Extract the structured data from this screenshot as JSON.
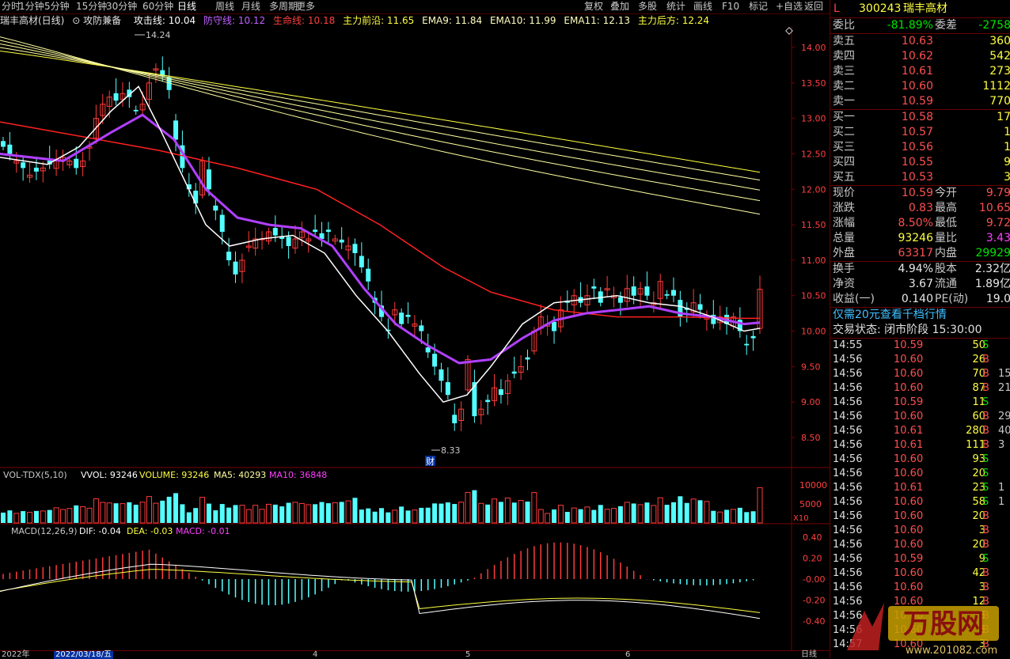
{
  "toolbar": {
    "periods": [
      "分时",
      "1分钟",
      "5分钟",
      "15分钟",
      "30分钟",
      "60分钟",
      "日线",
      "周线",
      "月线",
      "多周期",
      "更多"
    ],
    "active": "日线",
    "actions": [
      "复权",
      "叠加",
      "多股",
      "统计",
      "画线",
      "F10",
      "标记",
      "+自选",
      "返回"
    ]
  },
  "info": {
    "name": "瑞丰高材(日线)",
    "indicator": "攻防兼备",
    "attack": "攻击线: 10.04",
    "defense": "防守线: 10.12",
    "life": "生命线: 10.18",
    "main_front": "主力前沿: 11.65",
    "ema9": "EMA9: 11.84",
    "ema10": "EMA10: 11.99",
    "ema11": "EMA11: 12.13",
    "main_back": "主力后方: 12.24"
  },
  "chart_data": {
    "type": "candlestick",
    "price_axis": [
      "14.00",
      "13.50",
      "13.00",
      "12.50",
      "12.00",
      "11.50",
      "11.00",
      "10.50",
      "10.00",
      "9.50",
      "9.00",
      "8.50"
    ],
    "high_label": "14.24",
    "low_label": "8.33",
    "event_label": "财",
    "vol_title": "VOL-TDX(5,10)",
    "vol_vvol": "VVOL: 93246",
    "vol_volume": "VOLUME: 93246",
    "vol_ma5": "MA5: 40293",
    "vol_ma10": "MA10: 36848",
    "vol_axis": [
      "10000",
      "5000"
    ],
    "vol_unit": "X10",
    "macd_title": "MACD(12,26,9)",
    "macd_dif": "DIF: -0.04",
    "macd_dea": "DEA: -0.03",
    "macd_macd": "MACD: -0.01",
    "macd_axis": [
      "0.40",
      "0.20",
      "-0.00",
      "-0.20",
      "-0.40"
    ],
    "dates": [
      "2022年",
      "2022/03/18/五",
      "4",
      "5",
      "6"
    ],
    "date_right": "日线"
  },
  "quote": {
    "code": "300243",
    "name": "瑞丰高材",
    "flag": "L",
    "weibi_label": "委比",
    "weibi": "-81.89%",
    "weicha_label": "委差",
    "weicha": "-2758",
    "asks": [
      {
        "label": "卖五",
        "price": "10.63",
        "vol": "360"
      },
      {
        "label": "卖四",
        "price": "10.62",
        "vol": "542"
      },
      {
        "label": "卖三",
        "price": "10.61",
        "vol": "273"
      },
      {
        "label": "卖二",
        "price": "10.60",
        "vol": "1112"
      },
      {
        "label": "卖一",
        "price": "10.59",
        "vol": "770"
      }
    ],
    "bids": [
      {
        "label": "买一",
        "price": "10.58",
        "vol": "17"
      },
      {
        "label": "买二",
        "price": "10.57",
        "vol": "1"
      },
      {
        "label": "买三",
        "price": "10.56",
        "vol": "1"
      },
      {
        "label": "买四",
        "price": "10.55",
        "vol": "9"
      },
      {
        "label": "买五",
        "price": "10.53",
        "vol": "3"
      }
    ],
    "stats": [
      {
        "l1": "现价",
        "v1": "10.59",
        "c1": "red",
        "l2": "今开",
        "v2": "9.79",
        "c2": "red"
      },
      {
        "l1": "涨跌",
        "v1": "0.83",
        "c1": "red",
        "l2": "最高",
        "v2": "10.65",
        "c2": "red"
      },
      {
        "l1": "涨幅",
        "v1": "8.50%",
        "c1": "red",
        "l2": "最低",
        "v2": "9.72",
        "c2": "red"
      },
      {
        "l1": "总量",
        "v1": "93246",
        "c1": "yellow",
        "l2": "量比",
        "v2": "3.43",
        "c2": "magenta"
      },
      {
        "l1": "外盘",
        "v1": "63317",
        "c1": "red",
        "l2": "内盘",
        "v2": "29929",
        "c2": "green"
      }
    ],
    "stats2": [
      {
        "l1": "换手",
        "v1": "4.94%",
        "l2": "股本",
        "v2": "2.32亿"
      },
      {
        "l1": "净资",
        "v1": "3.67",
        "l2": "流通",
        "v2": "1.89亿"
      },
      {
        "l1": "收益(一)",
        "v1": "0.140",
        "l2": "PE(动)",
        "v2": "19.0"
      }
    ],
    "promo": "仅需20元查看千档行情",
    "status": "交易状态: 闭市阶段 15:30:00"
  },
  "trades": [
    {
      "t": "14:55",
      "p": "10.59",
      "q": "50",
      "d": "S",
      "x": ""
    },
    {
      "t": "14:56",
      "p": "10.60",
      "q": "26",
      "d": "B",
      "x": ""
    },
    {
      "t": "14:56",
      "p": "10.60",
      "q": "70",
      "d": "B",
      "x": "15"
    },
    {
      "t": "14:56",
      "p": "10.60",
      "q": "87",
      "d": "B",
      "x": "21"
    },
    {
      "t": "14:56",
      "p": "10.59",
      "q": "11",
      "d": "S",
      "x": ""
    },
    {
      "t": "14:56",
      "p": "10.60",
      "q": "60",
      "d": "B",
      "x": "29"
    },
    {
      "t": "14:56",
      "p": "10.61",
      "q": "280",
      "d": "B",
      "x": "40"
    },
    {
      "t": "14:56",
      "p": "10.61",
      "q": "111",
      "d": "B",
      "x": "3"
    },
    {
      "t": "14:56",
      "p": "10.60",
      "q": "93",
      "d": "S",
      "x": ""
    },
    {
      "t": "14:56",
      "p": "10.60",
      "q": "20",
      "d": "S",
      "x": ""
    },
    {
      "t": "14:56",
      "p": "10.61",
      "q": "23",
      "d": "S",
      "x": "1"
    },
    {
      "t": "14:56",
      "p": "10.60",
      "q": "58",
      "d": "S",
      "x": "1"
    },
    {
      "t": "14:56",
      "p": "10.60",
      "q": "20",
      "d": "B",
      "x": ""
    },
    {
      "t": "14:56",
      "p": "10.60",
      "q": "3",
      "d": "B",
      "x": ""
    },
    {
      "t": "14:56",
      "p": "10.60",
      "q": "20",
      "d": "B",
      "x": ""
    },
    {
      "t": "14:56",
      "p": "10.59",
      "q": "9",
      "d": "S",
      "x": ""
    },
    {
      "t": "14:56",
      "p": "10.60",
      "q": "42",
      "d": "B",
      "x": ""
    },
    {
      "t": "14:56",
      "p": "10.60",
      "q": "3",
      "d": "B",
      "x": ""
    },
    {
      "t": "14:56",
      "p": "10.60",
      "q": "12",
      "d": "B",
      "x": ""
    },
    {
      "t": "14:56",
      "p": "10.60",
      "q": "3",
      "d": "B",
      "x": ""
    },
    {
      "t": "14:56",
      "p": "10.60",
      "q": "3",
      "d": "B",
      "x": ""
    },
    {
      "t": "14:57",
      "p": "10.60",
      "q": "3",
      "d": "B",
      "x": ""
    }
  ],
  "colors": {
    "up": "#ff3b3b",
    "down": "#54ffff",
    "grid": "#7a0000",
    "attack": "#ffffff",
    "defense": "#b040ff",
    "life": "#ff2020",
    "ema": "#ffff80"
  }
}
